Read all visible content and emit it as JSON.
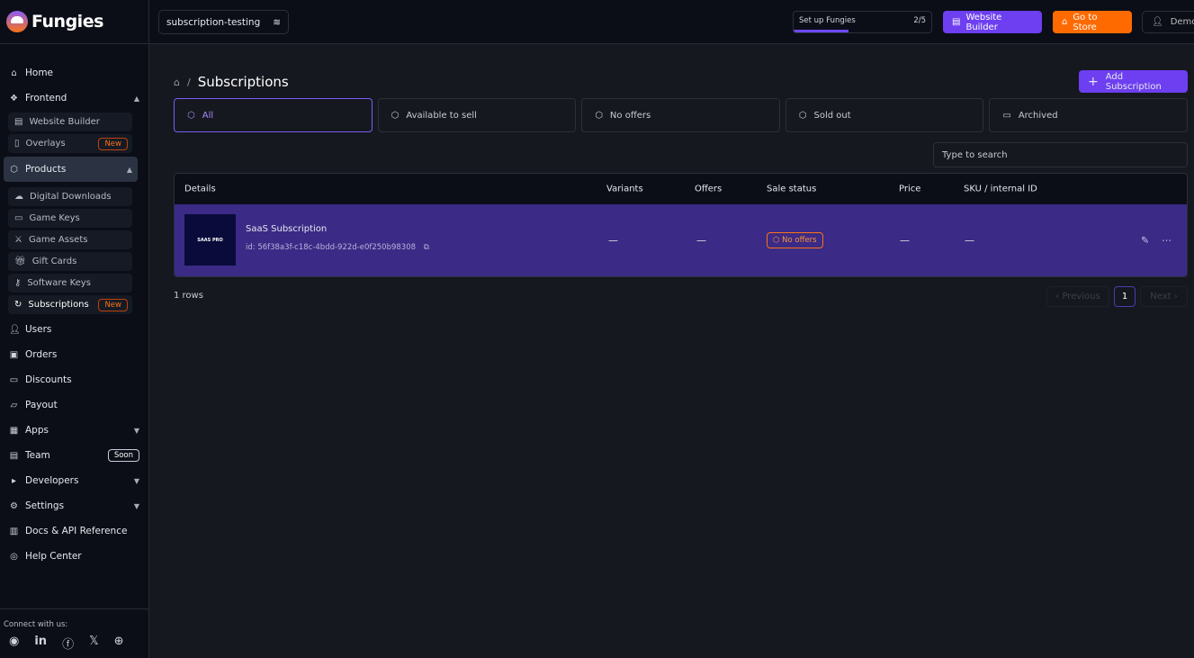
{
  "brand": "Fungies",
  "sidebar": {
    "items": [
      {
        "label": "Home",
        "icon": "home-icon"
      },
      {
        "label": "Frontend",
        "icon": "frontend-icon"
      },
      {
        "label": "Website Builder"
      },
      {
        "label": "Overlays",
        "badge": "New"
      },
      {
        "label": "Products"
      },
      {
        "label": "Digital Downloads"
      },
      {
        "label": "Game Keys"
      },
      {
        "label": "Game Assets"
      },
      {
        "label": "Gift Cards"
      },
      {
        "label": "Software Keys"
      },
      {
        "label": "Subscriptions",
        "badge": "New"
      },
      {
        "label": "Users"
      },
      {
        "label": "Orders"
      },
      {
        "label": "Discounts"
      },
      {
        "label": "Payout"
      },
      {
        "label": "Apps"
      },
      {
        "label": "Team",
        "badge": "Soon"
      },
      {
        "label": "Developers"
      },
      {
        "label": "Settings"
      },
      {
        "label": "Docs & API Reference"
      },
      {
        "label": "Help Center"
      }
    ],
    "connect": "Connect with us:"
  },
  "header": {
    "store": "subscription-testing",
    "setup_label": "Set up Fungies",
    "setup_count": "2/5",
    "setup_progress": 0.4,
    "website_builder": "Website Builder",
    "go_to_store": "Go to Store",
    "user": "Demo"
  },
  "page": {
    "title": "Subscriptions",
    "add": "Add Subscription",
    "search_placeholder": "Type to search",
    "tabs": [
      "All",
      "Available to sell",
      "No offers",
      "Sold out",
      "Archived"
    ],
    "columns": [
      "Details",
      "Variants",
      "Offers",
      "Sale status",
      "Price",
      "SKU / internal ID"
    ],
    "rows": [
      {
        "thumb": "SAAS PRO",
        "name": "SaaS Subscription",
        "id": "id: 56f38a3f-c18c-4bdd-922d-e0f250b98308",
        "variants": "—",
        "offers": "—",
        "status": "No offers",
        "price": "—",
        "sku": "—"
      }
    ],
    "rows_count": "1 rows",
    "prev": "‹  Previous",
    "page": "1",
    "next": "Next  ›"
  },
  "colors": {
    "accent": "#6d3ff0",
    "store": "#ff6a00",
    "row": "#3b2a86"
  }
}
